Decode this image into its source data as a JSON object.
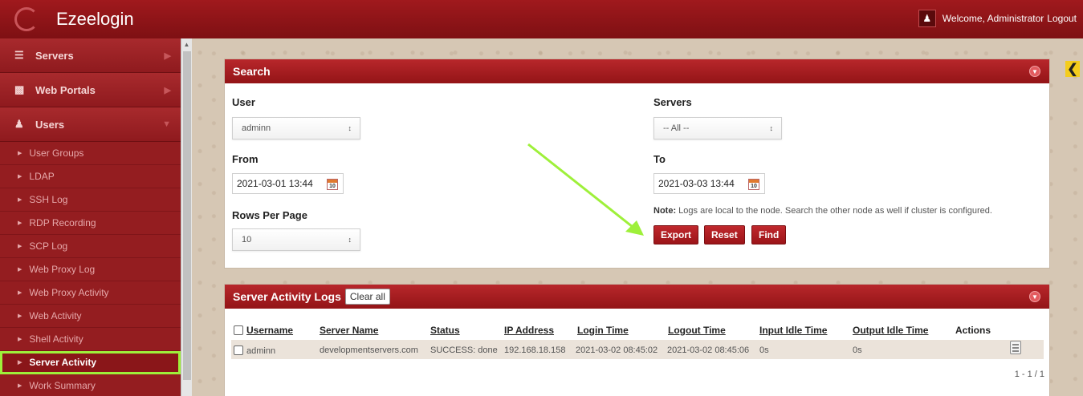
{
  "app": {
    "title": "Ezeelogin"
  },
  "topbar": {
    "welcome": "Welcome, Administrator",
    "logout": "Logout"
  },
  "sidebar": {
    "main": [
      {
        "label": "Servers",
        "icon": "list-icon"
      },
      {
        "label": "Web Portals",
        "icon": "grid-icon"
      },
      {
        "label": "Users",
        "icon": "users-icon"
      }
    ],
    "subitems": [
      "User Groups",
      "LDAP",
      "SSH Log",
      "RDP Recording",
      "SCP Log",
      "Web Proxy Log",
      "Web Proxy Activity",
      "Web Activity",
      "Shell Activity",
      "Server Activity",
      "Work Summary"
    ],
    "active": "Server Activity"
  },
  "search": {
    "title": "Search",
    "user_label": "User",
    "user_value": "adminn",
    "servers_label": "Servers",
    "servers_value": "-- All --",
    "from_label": "From",
    "from_value": "2021-03-01 13:44",
    "to_label": "To",
    "to_value": "2021-03-03 13:44",
    "calendar_day": "10",
    "rows_label": "Rows Per Page",
    "rows_value": "10",
    "note_bold": "Note:",
    "note_text": " Logs are local to the node. Search the other node as well if cluster is configured.",
    "buttons": {
      "export": "Export",
      "reset": "Reset",
      "find": "Find"
    }
  },
  "logs": {
    "title": "Server Activity Logs",
    "clear_all": "Clear all",
    "columns": [
      "Username",
      "Server Name",
      "Status",
      "IP Address",
      "Login Time",
      "Logout Time",
      "Input Idle Time",
      "Output Idle Time",
      "Actions"
    ],
    "rows": [
      {
        "username": "adminn",
        "server": "developmentservers.com",
        "status": "SUCCESS: done",
        "ip": "192.168.18.158",
        "login": "2021-03-02 08:45:02",
        "logout": "2021-03-02 08:45:06",
        "input_idle": "0s",
        "output_idle": "0s"
      }
    ],
    "pager": "1 - 1 / 1"
  },
  "colors": {
    "brand": "#a0191d",
    "highlight": "#9ef03a",
    "toggle": "#f4cc1c"
  }
}
